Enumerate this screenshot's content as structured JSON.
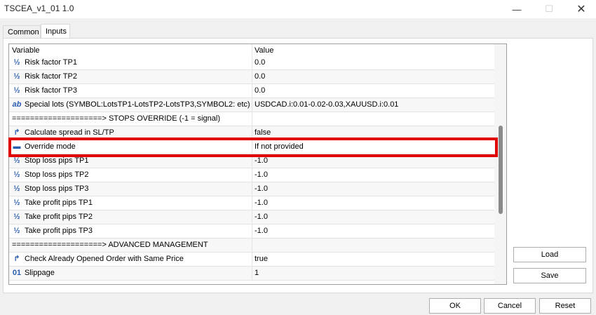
{
  "window": {
    "title": "TSCEA_v1_01 1.0",
    "minimize_glyph": "—",
    "maximize_glyph": "☐",
    "close_glyph": "✕"
  },
  "tabs": [
    {
      "label": "Common",
      "active": false
    },
    {
      "label": "Inputs",
      "active": true
    }
  ],
  "grid": {
    "col_variable": "Variable",
    "col_value": "Value",
    "rows": [
      {
        "icon": "half-icon",
        "glyph": "½",
        "name": "Risk factor TP1",
        "value": "0.0"
      },
      {
        "icon": "half-icon",
        "glyph": "½",
        "name": "Risk factor TP2",
        "value": "0.0"
      },
      {
        "icon": "half-icon",
        "glyph": "½",
        "name": "Risk factor TP3",
        "value": "0.0"
      },
      {
        "icon": "string-icon",
        "glyph": "ab",
        "name": "Special lots (SYMBOL:LotsTP1-LotsTP2-LotsTP3,SYMBOL2: etc)",
        "value": "USDCAD.i:0.01-0.02-0.03,XAUUSD.i:0.01"
      },
      {
        "icon": "",
        "glyph": "",
        "name": "====================> STOPS OVERRIDE (-1 = signal)",
        "value": ""
      },
      {
        "icon": "bool-arrow-icon",
        "glyph": "↱",
        "name": "Calculate spread in SL/TP",
        "value": "false"
      },
      {
        "icon": "enum-icon",
        "glyph": "▬",
        "name": "Override mode",
        "value": "If not provided"
      },
      {
        "icon": "half-icon",
        "glyph": "½",
        "name": "Stop loss pips TP1",
        "value": "-1.0"
      },
      {
        "icon": "half-icon",
        "glyph": "½",
        "name": "Stop loss pips TP2",
        "value": "-1.0"
      },
      {
        "icon": "half-icon",
        "glyph": "½",
        "name": "Stop loss pips TP3",
        "value": "-1.0"
      },
      {
        "icon": "half-icon",
        "glyph": "½",
        "name": "Take profit pips TP1",
        "value": "-1.0"
      },
      {
        "icon": "half-icon",
        "glyph": "½",
        "name": "Take profit pips TP2",
        "value": "-1.0"
      },
      {
        "icon": "half-icon",
        "glyph": "½",
        "name": "Take profit pips TP3",
        "value": "-1.0"
      },
      {
        "icon": "",
        "glyph": "",
        "name": "====================> ADVANCED MANAGEMENT",
        "value": ""
      },
      {
        "icon": "bool-arrow-icon",
        "glyph": "↱",
        "name": "Check Already Opened Order with Same Price",
        "value": "true"
      },
      {
        "icon": "int-icon",
        "glyph": "01",
        "name": "Slippage",
        "value": "1"
      }
    ]
  },
  "buttons": {
    "load": "Load",
    "save": "Save",
    "ok": "OK",
    "cancel": "Cancel",
    "reset": "Reset"
  },
  "colors": {
    "highlight": "#e00000",
    "accent": "#2a5db0"
  }
}
